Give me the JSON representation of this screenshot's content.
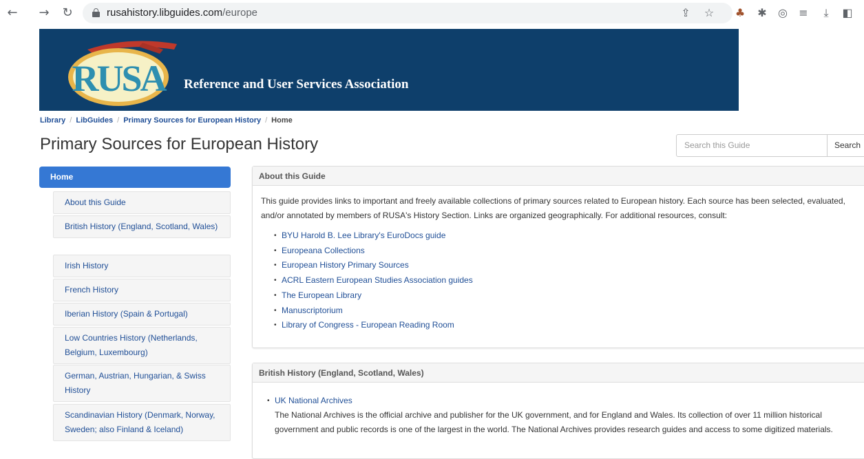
{
  "browser": {
    "url_domain": "rusahistory.libguides.com",
    "url_path": "/europe"
  },
  "banner": {
    "logo_text": "RUSA",
    "org_name": "Reference and User Services Association"
  },
  "breadcrumb": [
    "Library",
    "LibGuides",
    "Primary Sources for European History",
    "Home"
  ],
  "page_title": "Primary Sources for European History",
  "search": {
    "placeholder": "Search this Guide",
    "button_label": "Search"
  },
  "sidebar": {
    "home_label": "Home",
    "items": [
      "About this Guide",
      "British History (England, Scotland, Wales)",
      "Irish History",
      "French History",
      "Iberian History (Spain & Portugal)",
      "Low Countries History (Netherlands, Belgium, Luxembourg)",
      "German, Austrian, Hungarian, & Swiss History",
      "Scandinavian History (Denmark, Norway, Sweden; also Finland & Iceland)"
    ]
  },
  "about_box": {
    "heading": "About this Guide",
    "intro": "This guide provides links to important and freely available collections of primary sources related to European history. Each source has been selected, evaluated, and/or annotated by members of RUSA's History Section. Links are organized geographically. For additional resources, consult:",
    "links": [
      "BYU Harold B. Lee Library's EuroDocs guide",
      "Europeana Collections",
      "European History Primary Sources",
      "ACRL Eastern European Studies Association guides",
      "The European Library",
      "Manuscriptorium",
      "Library of Congress - European Reading Room"
    ]
  },
  "british_box": {
    "heading": "British History (England, Scotland, Wales)",
    "item_link": "UK National Archives",
    "item_desc": "The National Archives is the official archive and publisher for the UK government, and for England and Wales. Its collection of over 11 million historical government and public records is one of the largest in the world. The National Archives provides research guides and access to some digitized materials."
  }
}
